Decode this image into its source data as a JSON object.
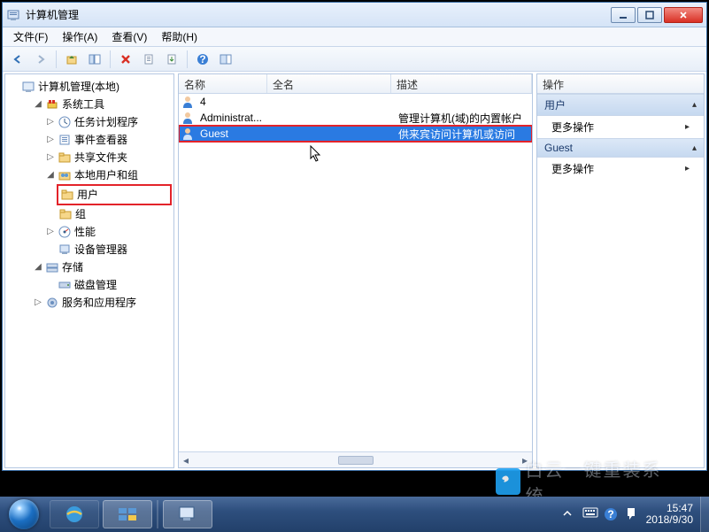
{
  "window": {
    "title": "计算机管理"
  },
  "menu": {
    "file": "文件(F)",
    "action": "操作(A)",
    "view": "查看(V)",
    "help": "帮助(H)"
  },
  "tree": {
    "root": "计算机管理(本地)",
    "system_tools": "系统工具",
    "task_scheduler": "任务计划程序",
    "event_viewer": "事件查看器",
    "shared_folders": "共享文件夹",
    "local_users_groups": "本地用户和组",
    "users": "用户",
    "groups": "组",
    "performance": "性能",
    "device_manager": "设备管理器",
    "storage": "存储",
    "disk_management": "磁盘管理",
    "services_apps": "服务和应用程序"
  },
  "list": {
    "col_name": "名称",
    "col_fullname": "全名",
    "col_desc": "描述",
    "rows": [
      {
        "name": "4",
        "fullname": "",
        "desc": ""
      },
      {
        "name": "Administrat...",
        "fullname": "",
        "desc": "管理计算机(域)的内置帐户"
      },
      {
        "name": "Guest",
        "fullname": "",
        "desc": "供来宾访问计算机或访问"
      }
    ]
  },
  "actions": {
    "header": "操作",
    "section1": "用户",
    "more1": "更多操作",
    "section2": "Guest",
    "more2": "更多操作"
  },
  "tray": {
    "time": "15:47",
    "date": "2018/9/30"
  },
  "watermark": "白云一键重装系统"
}
